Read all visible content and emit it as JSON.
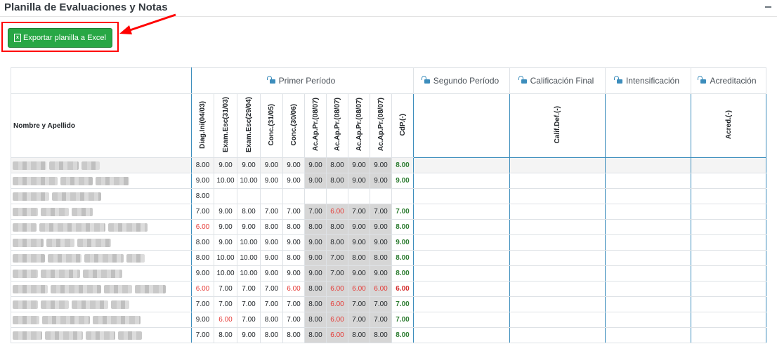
{
  "panel": {
    "title": "Planilla de Evaluaciones y Notas",
    "collapse_icon": "minus-icon",
    "export_label": "Exportar planilla a Excel",
    "export_icon": "excel-file-icon",
    "accent_color": "#28a745",
    "highlight_color": "#ff0000"
  },
  "table": {
    "periods": [
      {
        "label": "Primer Período",
        "icon": "unlock-icon"
      },
      {
        "label": "Segundo Período",
        "icon": "unlock-icon"
      },
      {
        "label": "Calificación Final",
        "icon": "unlock-icon"
      },
      {
        "label": "Intensificación",
        "icon": "unlock-icon"
      },
      {
        "label": "Acreditación",
        "icon": "unlock-icon"
      }
    ],
    "name_header": "Nombre y Apellido",
    "columns": [
      "Diag.Ini(04/03)",
      "Exam.Esc(31/03)",
      "Exam.Esc(29/04)",
      "Conc.(31/05)",
      "Conc.(30/06)",
      "Ac.Ap.Pr.(08/07)",
      "Ac.Ap.Pr.(08/07)",
      "Ac.Ap.Pr.(08/07)",
      "Ac.Ap.Pr.(08/07)",
      "CdP.(-)"
    ],
    "calif_def_header": "Calif.Def.(-)",
    "acred_header": "Acred.(-)",
    "rows": [
      {
        "name_redacted": true,
        "grades": [
          "8.00",
          "9.00",
          "9.00",
          "9.00",
          "9.00",
          "9.00",
          "8.00",
          "9.00",
          "9.00",
          "8.00"
        ]
      },
      {
        "name_redacted": true,
        "grades": [
          "9.00",
          "10.00",
          "10.00",
          "9.00",
          "9.00",
          "9.00",
          "8.00",
          "9.00",
          "9.00",
          "9.00"
        ]
      },
      {
        "name_redacted": true,
        "grades": [
          "8.00",
          "",
          "",
          "",
          "",
          "",
          "",
          "",
          "",
          ""
        ]
      },
      {
        "name_redacted": true,
        "grades": [
          "7.00",
          "9.00",
          "8.00",
          "7.00",
          "7.00",
          "7.00",
          "6.00",
          "7.00",
          "7.00",
          "7.00"
        ]
      },
      {
        "name_redacted": true,
        "grades": [
          "6.00",
          "9.00",
          "9.00",
          "8.00",
          "8.00",
          "8.00",
          "8.00",
          "9.00",
          "9.00",
          "8.00"
        ]
      },
      {
        "name_redacted": true,
        "grades": [
          "8.00",
          "9.00",
          "10.00",
          "9.00",
          "9.00",
          "9.00",
          "8.00",
          "9.00",
          "9.00",
          "9.00"
        ]
      },
      {
        "name_redacted": true,
        "grades": [
          "8.00",
          "10.00",
          "10.00",
          "9.00",
          "8.00",
          "9.00",
          "7.00",
          "8.00",
          "8.00",
          "8.00"
        ]
      },
      {
        "name_redacted": true,
        "grades": [
          "9.00",
          "10.00",
          "10.00",
          "9.00",
          "9.00",
          "9.00",
          "7.00",
          "9.00",
          "9.00",
          "8.00"
        ]
      },
      {
        "name_redacted": true,
        "grades": [
          "6.00",
          "7.00",
          "7.00",
          "7.00",
          "6.00",
          "8.00",
          "6.00",
          "6.00",
          "6.00",
          "6.00"
        ]
      },
      {
        "name_redacted": true,
        "grades": [
          "7.00",
          "7.00",
          "7.00",
          "7.00",
          "7.00",
          "8.00",
          "6.00",
          "7.00",
          "7.00",
          "7.00"
        ]
      },
      {
        "name_redacted": true,
        "grades": [
          "9.00",
          "6.00",
          "7.00",
          "8.00",
          "7.00",
          "8.00",
          "6.00",
          "7.00",
          "7.00",
          "7.00"
        ]
      },
      {
        "name_redacted": true,
        "grades": [
          "7.00",
          "8.00",
          "9.00",
          "8.00",
          "8.00",
          "8.00",
          "6.00",
          "8.00",
          "8.00",
          "8.00"
        ]
      }
    ],
    "colors": {
      "border_accent": "#3c8dbc",
      "failing": "#e53935",
      "passing_avg": "#2e7d32"
    }
  }
}
